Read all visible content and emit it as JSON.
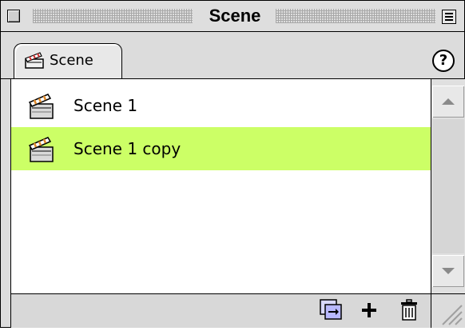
{
  "window": {
    "title": "Scene"
  },
  "tabs": [
    {
      "label": "Scene",
      "icon": "clapperboard-icon"
    }
  ],
  "help": {
    "label": "?"
  },
  "scenes": [
    {
      "label": "Scene 1",
      "icon": "clapperboard-icon",
      "selected": false
    },
    {
      "label": "Scene 1 copy",
      "icon": "clapperboard-icon",
      "selected": true
    }
  ],
  "toolbar": {
    "duplicate_icon": "duplicate-scene-icon",
    "add_icon": "add-scene-icon",
    "delete_icon": "trash-icon"
  },
  "colors": {
    "selection": "#ccff66",
    "chrome": "#dcdcdc"
  }
}
